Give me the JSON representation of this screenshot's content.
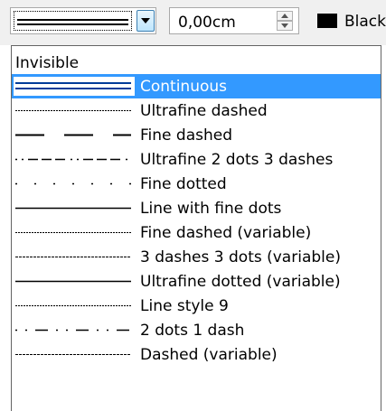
{
  "toolbar": {
    "width_value": "0,00cm",
    "color_label": "Black",
    "color_swatch": "#000000"
  },
  "colors": {
    "selection": "#3399ff",
    "selected_text": "#ffffff"
  },
  "line_styles": [
    {
      "label": "Invisible",
      "icon": "invisible-line-icon"
    },
    {
      "label": "Continuous",
      "icon": "continuous-line-icon",
      "selected": true
    },
    {
      "label": "Ultrafine dashed",
      "icon": "ultrafine-dashed-line-icon"
    },
    {
      "label": "Fine dashed",
      "icon": "fine-dashed-line-icon"
    },
    {
      "label": "Ultrafine 2 dots 3 dashes",
      "icon": "ultrafine-2-dots-3-dashes-line-icon"
    },
    {
      "label": "Fine dotted",
      "icon": "fine-dotted-line-icon"
    },
    {
      "label": "Line with fine dots",
      "icon": "line-with-fine-dots-icon"
    },
    {
      "label": "Fine dashed (variable)",
      "icon": "fine-dashed-variable-line-icon"
    },
    {
      "label": "3 dashes 3 dots (variable)",
      "icon": "3-dashes-3-dots-variable-line-icon"
    },
    {
      "label": "Ultrafine dotted (variable)",
      "icon": "ultrafine-dotted-variable-line-icon"
    },
    {
      "label": "Line style 9",
      "icon": "line-style-9-icon"
    },
    {
      "label": "2 dots 1 dash",
      "icon": "2-dots-1-dash-line-icon"
    },
    {
      "label": "Dashed (variable)",
      "icon": "dashed-variable-line-icon"
    }
  ]
}
